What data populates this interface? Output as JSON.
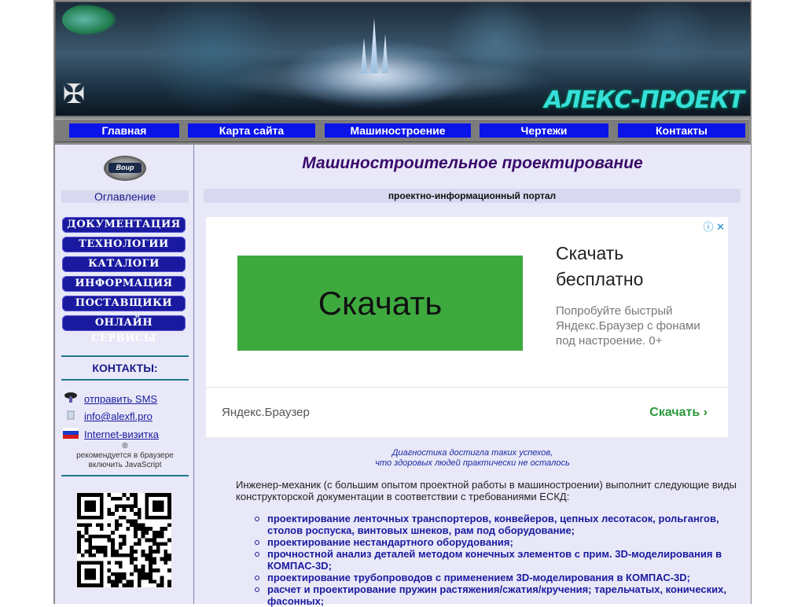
{
  "banner": {
    "logo_text": "АЛЕКС-ПРОЕКТ"
  },
  "nav": {
    "items": [
      {
        "label": "Главная"
      },
      {
        "label": "Карта сайта"
      },
      {
        "label": "Машиностроение"
      },
      {
        "label": "Чертежи"
      },
      {
        "label": "Контакты"
      }
    ]
  },
  "sidebar": {
    "toc_logo_text": "Воир",
    "toc_label": "Оглавление",
    "menu": [
      {
        "label": "ДОКУМЕНТАЦИЯ"
      },
      {
        "label": "ТЕХНОЛОГИИ"
      },
      {
        "label": "КАТАЛОГИ"
      },
      {
        "label": "ИНФОРМАЦИЯ"
      },
      {
        "label": "ПОСТАВЩИКИ"
      },
      {
        "label": "ОНЛАЙН СЕРВИСЫ"
      }
    ],
    "contacts_title": "КОНТАКТЫ:",
    "contacts": [
      {
        "label": "отправить SMS",
        "icon": "phone-icon"
      },
      {
        "label": "info@alexfl.pro",
        "icon": "email-icon"
      },
      {
        "label": "Internet-визитка",
        "icon": "flag-icon"
      }
    ],
    "reg_mark": "®",
    "js_note": "рекомендуется в браузере включить JavaScript"
  },
  "main": {
    "title": "Машиностроительное проектирование",
    "subtitle": "проектно-информационный портал",
    "ad": {
      "choices": "ⓘ ✕",
      "button_text": "Скачать",
      "headline": "Скачать бесплатно",
      "body": "Попробуйте быстрый Яндекс.Браузер с фонами под настроение. 0+",
      "brand": "Яндекс.Браузер",
      "cta": "Скачать ›"
    },
    "quote_line1": "Диагностика достигла таких успехов,",
    "quote_line2": "что здоровых людей практически не осталось",
    "intro": "Инженер-механик (с большим опытом проектной работы в машиностроении) выполнит следующие виды конструкторской документации в соответствии с требованиями ЕСКД:",
    "services": [
      "проектирование ленточных транспортеров, конвейеров, цепных лесотасок, рольгангов, столов роспуска, винтовых шнеков, рам под оборудование;",
      "проектирование нестандартного оборудования;",
      "прочностной анализ деталей методом конечных элементов с прим. 3D-моделирования в КОМПАС-3D;",
      "проектирование трубопроводов с применением 3D-моделирования в КОМПАС-3D;",
      "расчет и проектирование пружин растяжения/сжатия/кручения; тарельчатых, конических, фасонных;"
    ]
  },
  "colors": {
    "nav_button": "#0a14e8",
    "menu_button": "#1a1aa0",
    "title": "#3a0a6a",
    "content_bg": "#e8e8f8",
    "ad_green": "#3eaa3e"
  }
}
